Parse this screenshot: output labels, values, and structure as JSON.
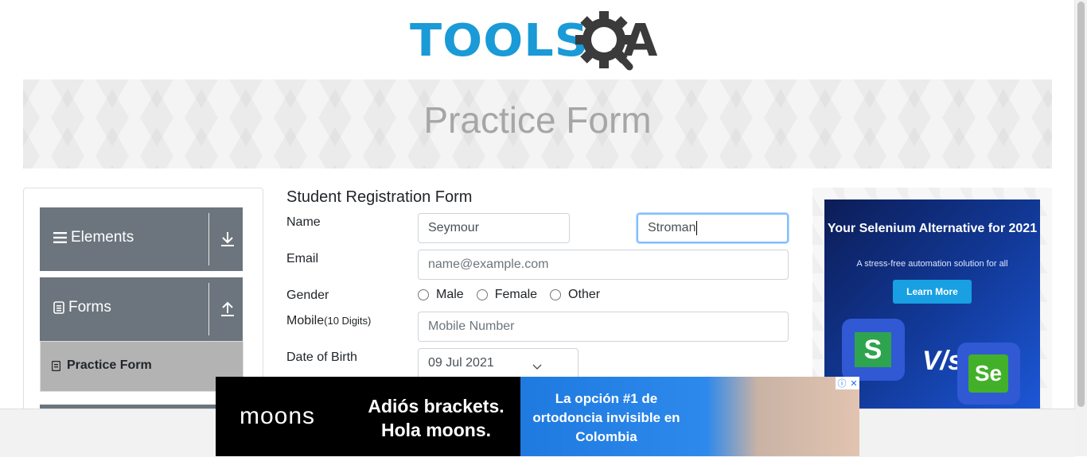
{
  "logo": {
    "text_tools": "TOOLS",
    "text_a": "A"
  },
  "banner": {
    "title": "Practice Form"
  },
  "sidebar": {
    "groups": [
      {
        "label": "Elements",
        "arrow": "download-icon"
      },
      {
        "label": "Forms",
        "arrow": "upload-icon"
      }
    ],
    "active_item": "Practice Form"
  },
  "form": {
    "title": "Student Registration Form",
    "name_label": "Name",
    "first_name_value": "Seymour",
    "last_name_value": "Stroman",
    "email_label": "Email",
    "email_placeholder": "name@example.com",
    "gender_label": "Gender",
    "gender_options": [
      "Male",
      "Female",
      "Other"
    ],
    "mobile_label": "Mobile",
    "mobile_hint": "(10 Digits)",
    "mobile_placeholder": "Mobile Number",
    "dob_label": "Date of Birth",
    "dob_value": "09 Jul 2021"
  },
  "ad_right": {
    "headline": "Your Selenium Alternative for 2021",
    "subline": "A stress-free automation solution for all",
    "button": "Learn More",
    "left_logo": "S",
    "vs": "V/s",
    "right_logo": "Se"
  },
  "ad_bottom": {
    "brand": "moons",
    "message": "Adiós brackets. Hola moons.",
    "promo": "La opción #1 de ortodoncia invisible en Colombia",
    "info_icon": "ⓘ",
    "close_icon": "✕"
  },
  "colors": {
    "accent": "#1a9ad6",
    "sidebar_group": "#6c757d",
    "active_item": "#b3b3b3",
    "focus_border": "#80bdff"
  }
}
